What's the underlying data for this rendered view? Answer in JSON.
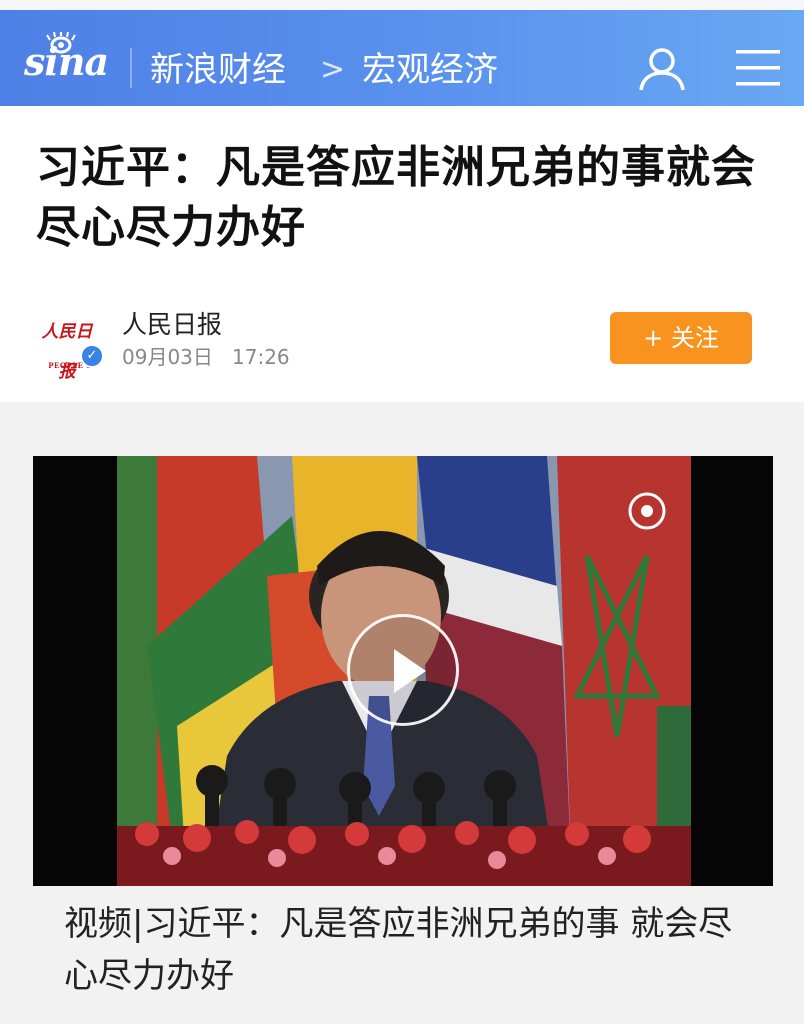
{
  "header": {
    "logo_text": "sina",
    "breadcrumb": [
      "新浪财经",
      "宏观经济"
    ],
    "separator": ">",
    "colors": {
      "bar": "#5a92ee",
      "text": "#ffffff"
    },
    "icons": [
      "user-icon",
      "menu-icon"
    ]
  },
  "article": {
    "title": "习近平：凡是答应非洲兄弟的事就会尽心尽力办好"
  },
  "author": {
    "avatar_text": "人民日报",
    "avatar_subtext": "PEOPLE'S DAILY",
    "name": "人民日报",
    "date": "09月03日",
    "time": "17:26",
    "follow_label": "+ 关注",
    "follow_color": "#f7931e"
  },
  "video": {
    "caption": "视频|习近平：凡是答应非洲兄弟的事 就会尽心尽力办好",
    "icons": [
      "play-icon"
    ]
  }
}
